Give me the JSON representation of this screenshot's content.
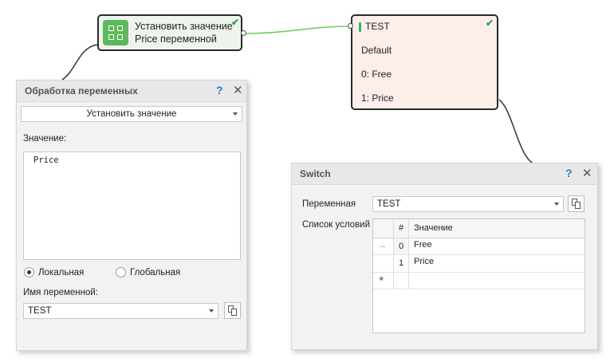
{
  "node_set": {
    "line1": "Установить значение",
    "line2": "Price переменной",
    "icon": "grid-icon",
    "status_icon": "check-icon"
  },
  "node_switch": {
    "name": "TEST",
    "rows": [
      "Default",
      "0: Free",
      "1: Price"
    ],
    "status_icon": "check-icon",
    "accent": "#22bb66"
  },
  "var_panel": {
    "title": "Обработка переменных",
    "help": "?",
    "close": "✕",
    "action": "Установить значение",
    "value_label": "Значение:",
    "value": "Price",
    "radio_local": "Локальная",
    "radio_global": "Глобальная",
    "name_label": "Имя переменной:",
    "name_value": "TEST"
  },
  "switch_panel": {
    "title": "Switch",
    "help": "?",
    "close": "✕",
    "var_label": "Переменная",
    "var_value": "TEST",
    "list_label": "Список условий",
    "grid": {
      "col_num": "#",
      "col_value": "Значение",
      "rows": [
        {
          "num": "0",
          "value": "Free"
        },
        {
          "num": "1",
          "value": "Price"
        }
      ],
      "current_marker": "→",
      "new_marker": "✷"
    }
  },
  "colors": {
    "node_set_bg": "#eef4ec",
    "node_switch_bg": "#fdeeea",
    "connector": "#6ccf5a",
    "check": "#2aa84a",
    "help": "#2b7ad6"
  }
}
